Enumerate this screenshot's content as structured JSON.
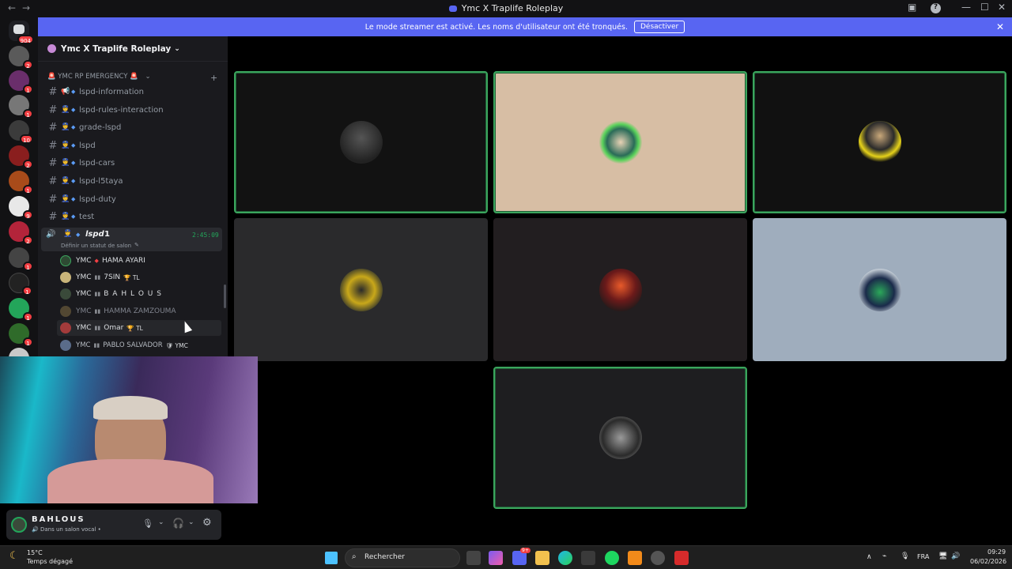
{
  "window": {
    "title": "Ymc X Traplife Roleplay",
    "back_icon": "←",
    "forward_icon": "→"
  },
  "banner": {
    "text": "Le mode streamer est activé. Les noms d'utilisateur ont été tronqués.",
    "button": "Désactiver"
  },
  "guilds": [
    {
      "badge": "904"
    },
    {
      "badge": "2"
    },
    {
      "badge": "1"
    },
    {
      "badge": "1"
    },
    {
      "badge": "10"
    },
    {
      "badge": "2"
    },
    {
      "badge": "1"
    },
    {
      "badge": "9"
    },
    {
      "badge": "2"
    },
    {
      "badge": "1"
    },
    {
      "badge": "1"
    },
    {
      "badge": "1"
    },
    {
      "badge": "1"
    },
    {
      "badge": ""
    }
  ],
  "server": {
    "name": "Ymc X Traplife Roleplay"
  },
  "category": {
    "name": "YMC RP EMERGENCY"
  },
  "channels": [
    {
      "name": "lspd-information",
      "emoji": "📢"
    },
    {
      "name": "lspd-rules-interaction",
      "emoji": ""
    },
    {
      "name": "grade-lspd",
      "emoji": ""
    },
    {
      "name": "lspd",
      "emoji": ""
    },
    {
      "name": "lspd-cars",
      "emoji": ""
    },
    {
      "name": "lspd-l5taya",
      "emoji": ""
    },
    {
      "name": "lspd-duty",
      "emoji": ""
    },
    {
      "name": "test",
      "emoji": ""
    }
  ],
  "voice_channel": {
    "name": "lspd",
    "count": "1",
    "timer": "2:45:09",
    "status_hint": "Définir un statut de salon"
  },
  "members": [
    {
      "prefix": "YMC",
      "sep": "◆",
      "name": "HAMA AYARI",
      "tag": ""
    },
    {
      "prefix": "YMC",
      "sep": "▮▮",
      "name": "7SIN",
      "tag": "🏆 TL"
    },
    {
      "prefix": "YMC",
      "sep": "▮▮",
      "name": "B A H L O U S",
      "tag": ""
    },
    {
      "prefix": "YMC",
      "sep": "▮▮",
      "name": "HAMMA ZAMZOUMA",
      "tag": ""
    },
    {
      "prefix": "YMC",
      "sep": "▮▮",
      "name": "Omar",
      "tag": "🏆 TL"
    },
    {
      "prefix": "YMC",
      "sep": "▮▮",
      "name": "PABLO SALVADOR",
      "tag": "🛡 YMC"
    }
  ],
  "user_panel": {
    "name": "BAHLOUS",
    "status": "Dans un salon vocal •"
  },
  "taskbar": {
    "weather_temp": "15°C",
    "weather_desc": "Temps dégagé",
    "search_placeholder": "Rechercher",
    "language": "FRA",
    "time": "09:29",
    "date": "06/02/2026",
    "discord_badge": "9+"
  },
  "colors": {
    "accent": "#5865f2",
    "speaking": "#3ba55d",
    "badge": "#f23f43"
  }
}
